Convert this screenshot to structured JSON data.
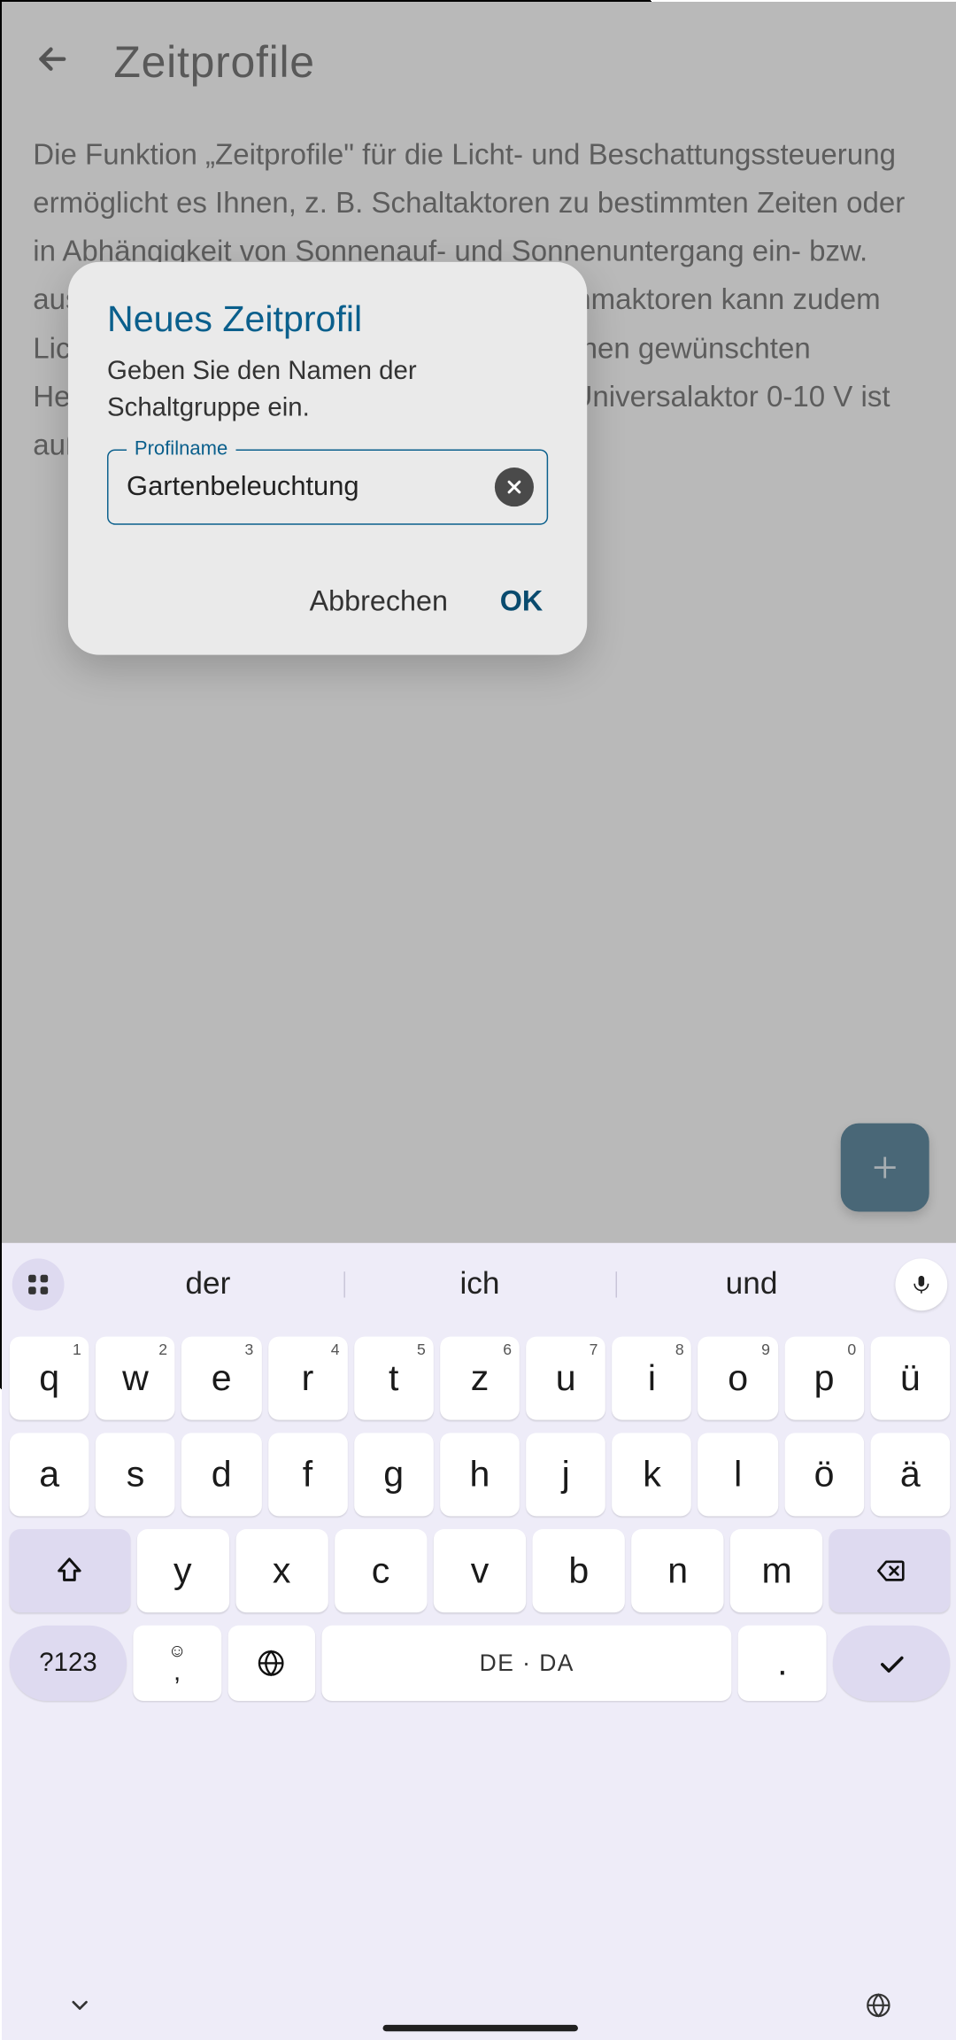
{
  "page": {
    "title": "Zeitprofile",
    "description": "Die Funktion „Zeitprofile\" für die Licht- und Beschattungssteuerung ermöglicht es Ihnen, z. B. Schaltaktoren zu bestimmten Zeiten oder in Abhängigkeit von Sonnenauf- und Sonnenuntergang ein- bzw. auszuschalten. Durch den Einsatz von Dimmaktoren kann zudem Licht innerhalb definierter Zeiträume auf einen gewünschten Helligkeitswert gedimmt werden. Für den Universalaktor 0-10 V ist außerdem ein Lüftungsprofil möglich."
  },
  "dialog": {
    "title": "Neues Zeitprofil",
    "subtitle": "Geben Sie den Namen der Schaltgruppe ein.",
    "field_label": "Profilname",
    "field_value": "Gartenbeleuchtung",
    "cancel": "Abbrechen",
    "ok": "OK"
  },
  "keyboard": {
    "suggestions": [
      "der",
      "ich",
      "und"
    ],
    "row1": [
      {
        "k": "q",
        "s": "1"
      },
      {
        "k": "w",
        "s": "2"
      },
      {
        "k": "e",
        "s": "3"
      },
      {
        "k": "r",
        "s": "4"
      },
      {
        "k": "t",
        "s": "5"
      },
      {
        "k": "z",
        "s": "6"
      },
      {
        "k": "u",
        "s": "7"
      },
      {
        "k": "i",
        "s": "8"
      },
      {
        "k": "o",
        "s": "9"
      },
      {
        "k": "p",
        "s": "0"
      },
      {
        "k": "ü",
        "s": ""
      }
    ],
    "row2": [
      "a",
      "s",
      "d",
      "f",
      "g",
      "h",
      "j",
      "k",
      "l",
      "ö",
      "ä"
    ],
    "row3": [
      "y",
      "x",
      "c",
      "v",
      "b",
      "n",
      "m"
    ],
    "space_label": "DE · DA",
    "symbols_label": "?123",
    "comma": ",",
    "period": "."
  }
}
